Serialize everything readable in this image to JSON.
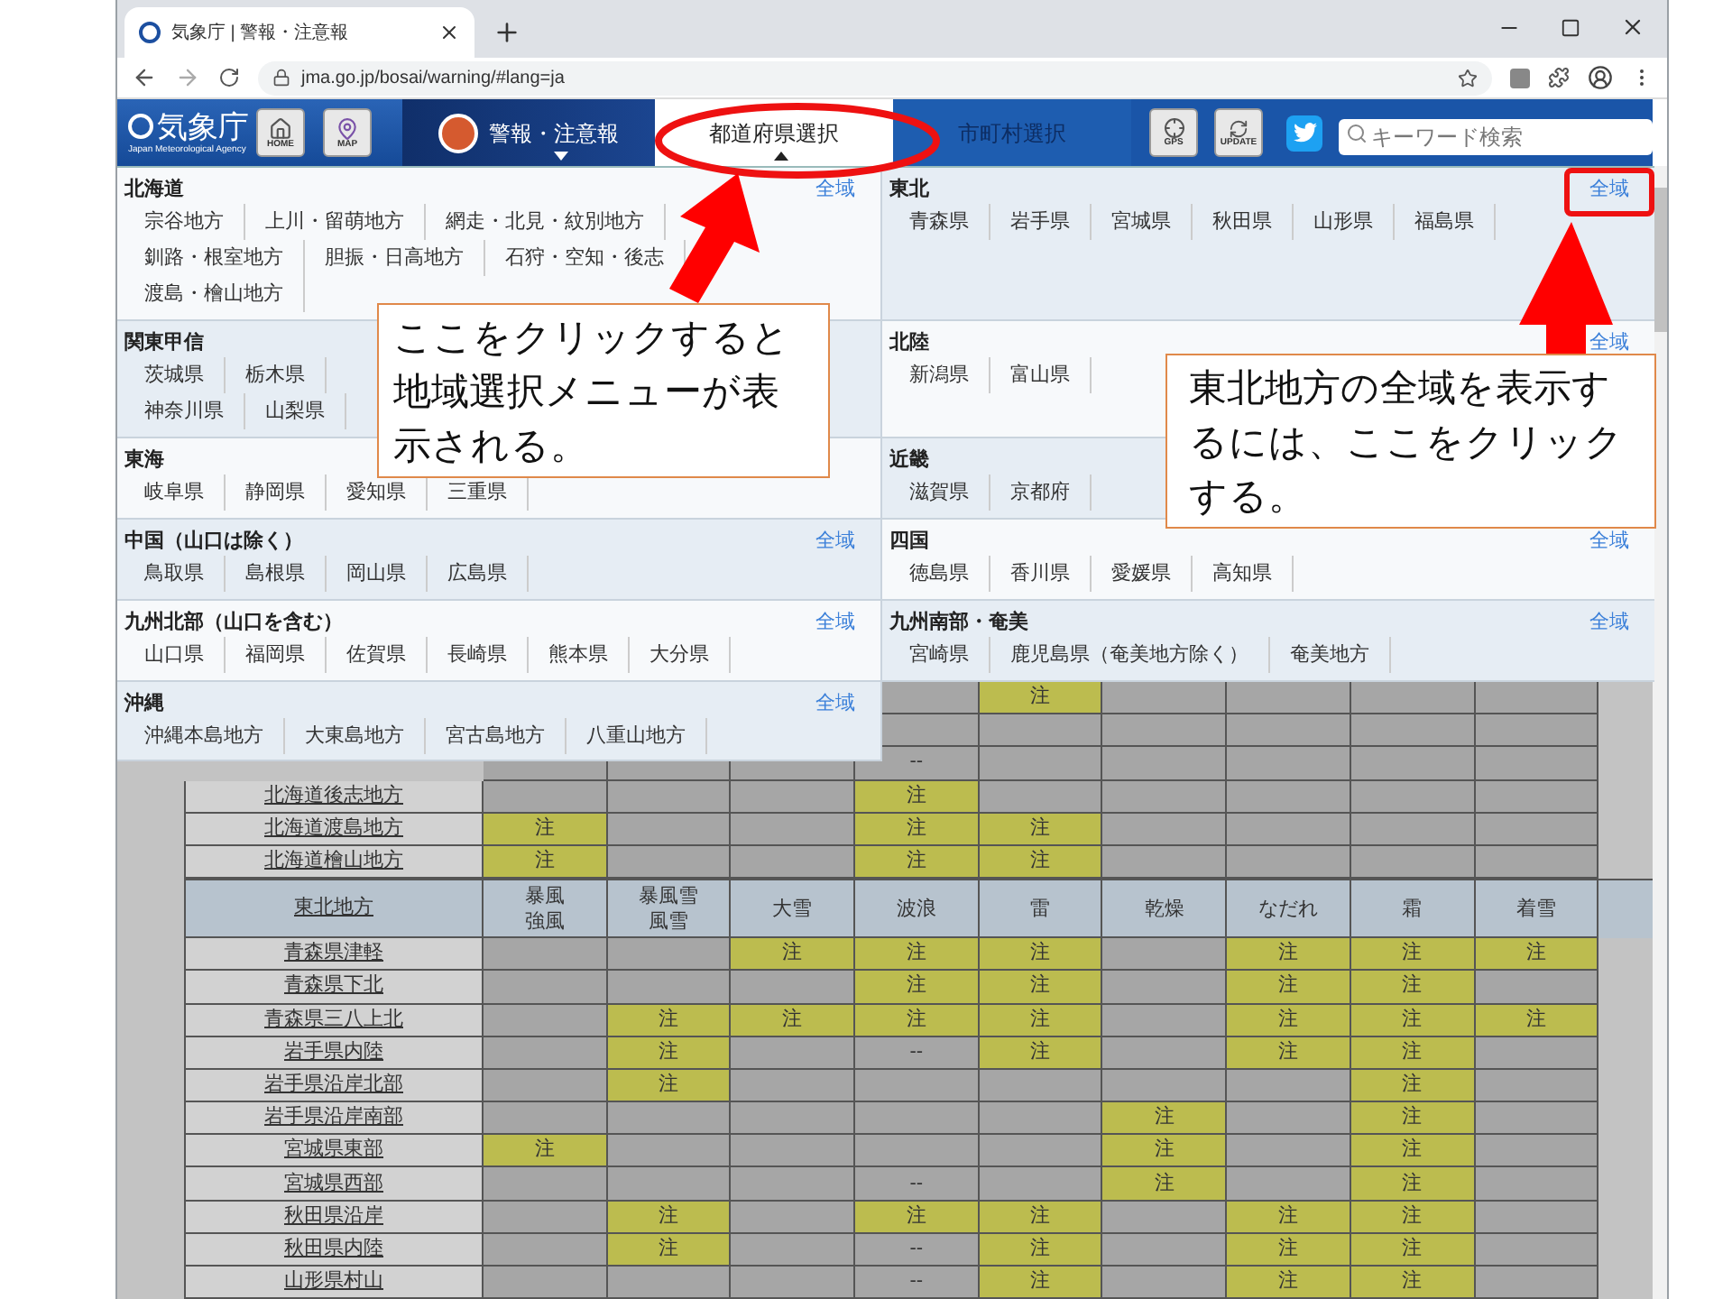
{
  "browser": {
    "tab_title": "気象庁 | 警報・注意報",
    "url": "jma.go.jp/bosai/warning/#lang=ja"
  },
  "header": {
    "logo_name": "気象庁",
    "logo_subtitle": "Japan Meteorological Agency",
    "home_label": "HOME",
    "map_label": "MAP",
    "gps_label": "GPS",
    "update_label": "UPDATE",
    "search": {
      "placeholder": "キーワード検索"
    },
    "nav": [
      {
        "label": "警報・注意報",
        "kind": "icon_menu",
        "selected": false,
        "disabled": false,
        "expanded": false
      },
      {
        "label": "都道府県選択",
        "kind": "menu",
        "selected": true,
        "disabled": false,
        "expanded": true
      },
      {
        "label": "市町村選択",
        "kind": "plain",
        "selected": false,
        "disabled": true
      }
    ]
  },
  "region_menu": {
    "sections": [
      {
        "name": "北海道",
        "all_label": "全域",
        "lines": [
          [
            "宗谷地方",
            "上川・留萌地方",
            "網走・北見・紋別地方"
          ],
          [
            "釧路・根室地方",
            "胆振・日高地方",
            "石狩・空知・後志"
          ],
          [
            "渡島・檜山地方"
          ]
        ]
      },
      {
        "name": "東北",
        "all_label": "全域",
        "lines": [
          [
            "青森県",
            "岩手県",
            "宮城県",
            "秋田県",
            "山形県",
            "福島県"
          ]
        ]
      },
      {
        "name": "関東甲信",
        "lines": [
          [
            "茨城県",
            "栃木県"
          ],
          [
            "神奈川県",
            "山梨県"
          ]
        ]
      },
      {
        "name": "北陸",
        "all_label": "全域",
        "lines": [
          [
            "新潟県",
            "富山県"
          ]
        ]
      },
      {
        "name": "東海",
        "lines": [
          [
            "岐阜県",
            "静岡県",
            "愛知県",
            "三重県"
          ]
        ]
      },
      {
        "name": "近畿",
        "lines": [
          [
            "滋賀県",
            "京都府"
          ]
        ]
      },
      {
        "name": "中国（山口は除く）",
        "all_label": "全域",
        "lines": [
          [
            "鳥取県",
            "島根県",
            "岡山県",
            "広島県"
          ]
        ]
      },
      {
        "name": "四国",
        "all_label": "全域",
        "lines": [
          [
            "徳島県",
            "香川県",
            "愛媛県",
            "高知県"
          ]
        ]
      },
      {
        "name": "九州北部（山口を含む）",
        "all_label": "全域",
        "lines": [
          [
            "山口県",
            "福岡県",
            "佐賀県",
            "長崎県",
            "熊本県",
            "大分県"
          ]
        ]
      },
      {
        "name": "九州南部・奄美",
        "all_label": "全域",
        "lines": [
          [
            "宮崎県",
            "鹿児島県（奄美地方除く）",
            "奄美地方"
          ]
        ]
      },
      {
        "name": "沖縄",
        "all_label": "全域",
        "lines": [
          [
            "沖縄本島地方",
            "大東島地方",
            "宮古島地方",
            "八重山地方"
          ]
        ]
      }
    ]
  },
  "table": {
    "upper_rows": [
      {
        "cells": [
          {
            "kind": "none"
          },
          {
            "kind": "caution",
            "text": "注"
          },
          {
            "kind": "none"
          },
          {
            "kind": "none"
          },
          {
            "kind": "none"
          },
          {
            "kind": "none"
          }
        ]
      },
      {
        "cells": [
          {
            "kind": "none"
          },
          {
            "kind": "none"
          },
          {
            "kind": "none"
          },
          {
            "kind": "none"
          },
          {
            "kind": "none"
          },
          {
            "kind": "none"
          }
        ]
      },
      {
        "cells": [
          {
            "kind": "none"
          },
          {
            "kind": "none"
          },
          {
            "kind": "none"
          },
          {
            "kind": "none",
            "text": "--"
          },
          {
            "kind": "none"
          },
          {
            "kind": "none"
          },
          {
            "kind": "none"
          },
          {
            "kind": "none"
          },
          {
            "kind": "none"
          }
        ]
      },
      {
        "label": "北海道後志地方",
        "cells": [
          {
            "kind": "none"
          },
          {
            "kind": "none"
          },
          {
            "kind": "none"
          },
          {
            "kind": "caution",
            "text": "注"
          },
          {
            "kind": "none"
          },
          {
            "kind": "none"
          },
          {
            "kind": "none"
          },
          {
            "kind": "none"
          },
          {
            "kind": "none"
          }
        ]
      },
      {
        "label": "北海道渡島地方",
        "cells": [
          {
            "kind": "caution",
            "text": "注"
          },
          {
            "kind": "none"
          },
          {
            "kind": "none"
          },
          {
            "kind": "caution",
            "text": "注"
          },
          {
            "kind": "caution",
            "text": "注"
          },
          {
            "kind": "none"
          },
          {
            "kind": "none"
          },
          {
            "kind": "none"
          },
          {
            "kind": "none"
          }
        ]
      },
      {
        "label": "北海道檜山地方",
        "cells": [
          {
            "kind": "caution",
            "text": "注"
          },
          {
            "kind": "none"
          },
          {
            "kind": "none"
          },
          {
            "kind": "caution",
            "text": "注"
          },
          {
            "kind": "caution",
            "text": "注"
          },
          {
            "kind": "none"
          },
          {
            "kind": "none"
          },
          {
            "kind": "none"
          },
          {
            "kind": "none"
          }
        ]
      }
    ],
    "region_header": {
      "label": "東北地方",
      "columns": [
        [
          "暴風",
          "強風"
        ],
        [
          "暴風雪",
          "風雪"
        ],
        [
          "大雪"
        ],
        [
          "波浪"
        ],
        [
          "雷"
        ],
        [
          "乾燥"
        ],
        [
          "なだれ"
        ],
        [
          "霜"
        ],
        [
          "着雪"
        ]
      ]
    },
    "rows": [
      {
        "label": "青森県津軽",
        "cells": [
          {
            "kind": "none"
          },
          {
            "kind": "none"
          },
          {
            "kind": "caution",
            "text": "注"
          },
          {
            "kind": "caution",
            "text": "注"
          },
          {
            "kind": "caution",
            "text": "注"
          },
          {
            "kind": "none"
          },
          {
            "kind": "caution",
            "text": "注"
          },
          {
            "kind": "caution",
            "text": "注"
          },
          {
            "kind": "caution",
            "text": "注"
          }
        ]
      },
      {
        "label": "青森県下北",
        "cells": [
          {
            "kind": "none"
          },
          {
            "kind": "none"
          },
          {
            "kind": "none"
          },
          {
            "kind": "caution",
            "text": "注"
          },
          {
            "kind": "caution",
            "text": "注"
          },
          {
            "kind": "none"
          },
          {
            "kind": "caution",
            "text": "注"
          },
          {
            "kind": "caution",
            "text": "注"
          },
          {
            "kind": "none"
          }
        ]
      },
      {
        "label": "青森県三八上北",
        "cells": [
          {
            "kind": "none"
          },
          {
            "kind": "caution",
            "text": "注"
          },
          {
            "kind": "caution",
            "text": "注"
          },
          {
            "kind": "caution",
            "text": "注"
          },
          {
            "kind": "caution",
            "text": "注"
          },
          {
            "kind": "none"
          },
          {
            "kind": "caution",
            "text": "注"
          },
          {
            "kind": "caution",
            "text": "注"
          },
          {
            "kind": "caution",
            "text": "注"
          }
        ]
      },
      {
        "label": "岩手県内陸",
        "cells": [
          {
            "kind": "none"
          },
          {
            "kind": "caution",
            "text": "注"
          },
          {
            "kind": "none"
          },
          {
            "kind": "none",
            "text": "--"
          },
          {
            "kind": "caution",
            "text": "注"
          },
          {
            "kind": "none"
          },
          {
            "kind": "caution",
            "text": "注"
          },
          {
            "kind": "caution",
            "text": "注"
          },
          {
            "kind": "none"
          }
        ]
      },
      {
        "label": "岩手県沿岸北部",
        "cells": [
          {
            "kind": "none"
          },
          {
            "kind": "caution",
            "text": "注"
          },
          {
            "kind": "none"
          },
          {
            "kind": "none"
          },
          {
            "kind": "none"
          },
          {
            "kind": "none"
          },
          {
            "kind": "none"
          },
          {
            "kind": "caution",
            "text": "注"
          },
          {
            "kind": "none"
          }
        ]
      },
      {
        "label": "岩手県沿岸南部",
        "cells": [
          {
            "kind": "none"
          },
          {
            "kind": "none"
          },
          {
            "kind": "none"
          },
          {
            "kind": "none"
          },
          {
            "kind": "none"
          },
          {
            "kind": "caution",
            "text": "注"
          },
          {
            "kind": "none"
          },
          {
            "kind": "caution",
            "text": "注"
          },
          {
            "kind": "none"
          }
        ]
      },
      {
        "label": "宮城県東部",
        "cells": [
          {
            "kind": "caution",
            "text": "注"
          },
          {
            "kind": "none"
          },
          {
            "kind": "none"
          },
          {
            "kind": "none"
          },
          {
            "kind": "none"
          },
          {
            "kind": "caution",
            "text": "注"
          },
          {
            "kind": "none"
          },
          {
            "kind": "caution",
            "text": "注"
          },
          {
            "kind": "none"
          }
        ]
      },
      {
        "label": "宮城県西部",
        "cells": [
          {
            "kind": "none"
          },
          {
            "kind": "none"
          },
          {
            "kind": "none"
          },
          {
            "kind": "none",
            "text": "--"
          },
          {
            "kind": "none"
          },
          {
            "kind": "caution",
            "text": "注"
          },
          {
            "kind": "none"
          },
          {
            "kind": "caution",
            "text": "注"
          },
          {
            "kind": "none"
          }
        ]
      },
      {
        "label": "秋田県沿岸",
        "cells": [
          {
            "kind": "none"
          },
          {
            "kind": "caution",
            "text": "注"
          },
          {
            "kind": "none"
          },
          {
            "kind": "caution",
            "text": "注"
          },
          {
            "kind": "caution",
            "text": "注"
          },
          {
            "kind": "none"
          },
          {
            "kind": "caution",
            "text": "注"
          },
          {
            "kind": "caution",
            "text": "注"
          },
          {
            "kind": "none"
          }
        ]
      },
      {
        "label": "秋田県内陸",
        "cells": [
          {
            "kind": "none"
          },
          {
            "kind": "caution",
            "text": "注"
          },
          {
            "kind": "none"
          },
          {
            "kind": "none",
            "text": "--"
          },
          {
            "kind": "caution",
            "text": "注"
          },
          {
            "kind": "none"
          },
          {
            "kind": "caution",
            "text": "注"
          },
          {
            "kind": "caution",
            "text": "注"
          },
          {
            "kind": "none"
          }
        ]
      },
      {
        "label": "山形県村山",
        "cells": [
          {
            "kind": "none"
          },
          {
            "kind": "none"
          },
          {
            "kind": "none"
          },
          {
            "kind": "none",
            "text": "--"
          },
          {
            "kind": "caution",
            "text": "注"
          },
          {
            "kind": "none"
          },
          {
            "kind": "caution",
            "text": "注"
          },
          {
            "kind": "caution",
            "text": "注"
          },
          {
            "kind": "none"
          }
        ]
      }
    ]
  },
  "annotations": [
    {
      "kind": "callout",
      "text": "ここをクリックすると地域選択メニューが表示される。"
    },
    {
      "kind": "callout",
      "text": "東北地方の全域を表示するには、ここをクリックする。"
    }
  ]
}
